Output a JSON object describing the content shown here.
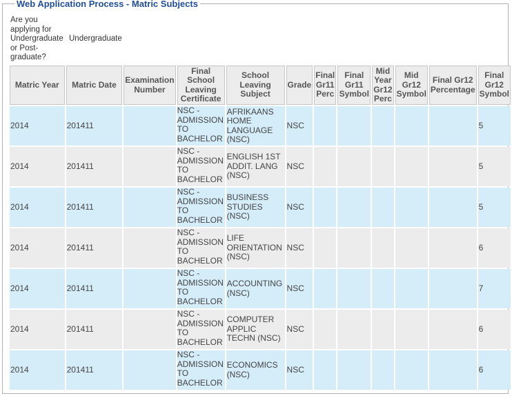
{
  "title": "Web Application Process - Matric Subjects",
  "applying": {
    "question": "Are you applying for Undergraduate or Post-graduate?",
    "answer": "Undergraduate"
  },
  "columns": [
    "Matric Year",
    "Matric Date",
    "Examination Number",
    "Final School Leaving Certificate",
    "School Leaving Subject",
    "Grade",
    "Final Gr11 Perc",
    "Final Gr11 Symbol",
    "Mid Year Gr12 Perc",
    "Mid Gr12 Symbol",
    "Final Gr12 Percentage",
    "Final Gr12 Symbol"
  ],
  "rows": [
    {
      "matric_year": "2014",
      "matric_date": "201411",
      "exam_number": "",
      "certificate": "NSC - ADMISSION TO BACHELOR",
      "subject": "AFRIKAANS HOME LANGUAGE (NSC)",
      "grade": "NSC",
      "gr11_perc": "",
      "gr11_symbol": "",
      "mid_gr12_perc": "",
      "mid_gr12_symbol": "",
      "final_gr12_perc": "",
      "final_gr12_symbol": "5"
    },
    {
      "matric_year": "2014",
      "matric_date": "201411",
      "exam_number": "",
      "certificate": "NSC - ADMISSION TO BACHELOR",
      "subject": "ENGLISH 1ST ADDIT. LANG (NSC)",
      "grade": "NSC",
      "gr11_perc": "",
      "gr11_symbol": "",
      "mid_gr12_perc": "",
      "mid_gr12_symbol": "",
      "final_gr12_perc": "",
      "final_gr12_symbol": "5"
    },
    {
      "matric_year": "2014",
      "matric_date": "201411",
      "exam_number": "",
      "certificate": "NSC - ADMISSION TO BACHELOR",
      "subject": "BUSINESS STUDIES (NSC)",
      "grade": "NSC",
      "gr11_perc": "",
      "gr11_symbol": "",
      "mid_gr12_perc": "",
      "mid_gr12_symbol": "",
      "final_gr12_perc": "",
      "final_gr12_symbol": "5"
    },
    {
      "matric_year": "2014",
      "matric_date": "201411",
      "exam_number": "",
      "certificate": "NSC - ADMISSION TO BACHELOR",
      "subject": "LIFE ORIENTATION (NSC)",
      "grade": "NSC",
      "gr11_perc": "",
      "gr11_symbol": "",
      "mid_gr12_perc": "",
      "mid_gr12_symbol": "",
      "final_gr12_perc": "",
      "final_gr12_symbol": "6"
    },
    {
      "matric_year": "2014",
      "matric_date": "201411",
      "exam_number": "",
      "certificate": "NSC - ADMISSION TO BACHELOR",
      "subject": "ACCOUNTING (NSC)",
      "grade": "NSC",
      "gr11_perc": "",
      "gr11_symbol": "",
      "mid_gr12_perc": "",
      "mid_gr12_symbol": "",
      "final_gr12_perc": "",
      "final_gr12_symbol": "7"
    },
    {
      "matric_year": "2014",
      "matric_date": "201411",
      "exam_number": "",
      "certificate": "NSC - ADMISSION TO BACHELOR",
      "subject": "COMPUTER APPLIC TECHN (NSC)",
      "grade": "NSC",
      "gr11_perc": "",
      "gr11_symbol": "",
      "mid_gr12_perc": "",
      "mid_gr12_symbol": "",
      "final_gr12_perc": "",
      "final_gr12_symbol": "6"
    },
    {
      "matric_year": "2014",
      "matric_date": "201411",
      "exam_number": "",
      "certificate": "NSC - ADMISSION TO BACHELOR",
      "subject": "ECONOMICS (NSC)",
      "grade": "NSC",
      "gr11_perc": "",
      "gr11_symbol": "",
      "mid_gr12_perc": "",
      "mid_gr12_symbol": "",
      "final_gr12_perc": "",
      "final_gr12_symbol": "6"
    }
  ],
  "colors": {
    "title": "#1f4e96",
    "row_blue": "#d5ecf9",
    "row_grey": "#ececec",
    "header_bg": "#ececec",
    "border": "#b0b0b0"
  }
}
